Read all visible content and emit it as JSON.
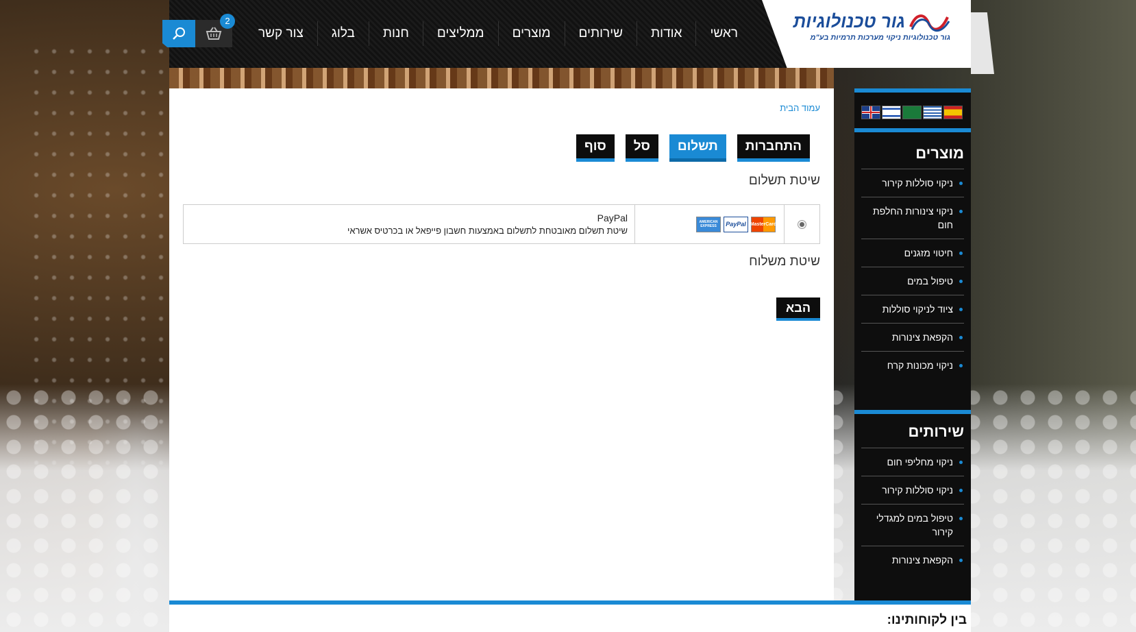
{
  "header": {
    "logo_title": "גור טכנולוגיות",
    "logo_subtitle": "גור טכנולוגיות ניקוי מערכות תרמיות בע\"מ",
    "nav": [
      "ראשי",
      "אודות",
      "שירותים",
      "מוצרים",
      "ממליצים",
      "חנות",
      "בלוג",
      "צור קשר"
    ],
    "cart_count": "2",
    "cart_icon": "basket-icon",
    "search_icon": "search-icon"
  },
  "breadcrumb": "עמוד הבית",
  "steps": [
    {
      "label": "התחברות",
      "active": false
    },
    {
      "label": "תשלום",
      "active": true
    },
    {
      "label": "סל",
      "active": false
    },
    {
      "label": "סוף",
      "active": false
    }
  ],
  "payment": {
    "title": "שיטת תשלום",
    "method_name": "PayPal",
    "method_desc": "שיטת תשלום מאובטחת לתשלום באמצעות חשבון פייפאל או בכרטיס אשראי",
    "selected": true,
    "cards": [
      "MasterCard",
      "PayPal",
      "AMERICAN EXPRESS"
    ]
  },
  "shipping": {
    "title": "שיטת משלוח"
  },
  "next_button": "הבא",
  "sidebar": {
    "flags": [
      "uk",
      "il",
      "sa",
      "gr",
      "es"
    ],
    "products_title": "מוצרים",
    "products": [
      "ניקוי סוללות קירור",
      "ניקוי צינורות החלפת חום",
      "חיטוי מזגנים",
      "טיפול במים",
      "ציוד לניקוי סוללות",
      "הקפאת צינורות",
      "ניקוי מכונות קרח"
    ],
    "services_title": "שירותים",
    "services": [
      "ניקוי מחליפי חום",
      "ניקוי סוללות קירור",
      "טיפול במים למגדלי קירור",
      "הקפאת צינורות"
    ]
  },
  "footer": {
    "title": "בין לקוחותינו:"
  },
  "colors": {
    "accent": "#1a8ad4",
    "dark": "#0e0e0e"
  }
}
